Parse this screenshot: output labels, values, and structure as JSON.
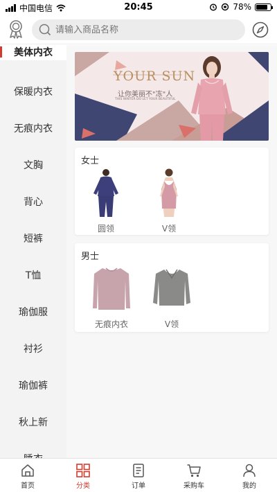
{
  "status_bar": {
    "carrier": "中国电信",
    "time": "20:45",
    "battery": "78%",
    "battery_level": 0.78
  },
  "header": {
    "search_placeholder": "请输入商品名称",
    "left_icon": "medal-icon",
    "right_icon": "compass-icon"
  },
  "sidebar": {
    "active": "美体内衣",
    "items": [
      "保暖内衣",
      "无痕内衣",
      "文胸",
      "背心",
      "短裤",
      "T恤",
      "瑜伽服",
      "衬衫",
      "瑜伽裤",
      "秋上新",
      "睡衣"
    ]
  },
  "banner": {
    "brand": "YOUR SUN",
    "slogan": "让你美丽不\"冻\"人",
    "tagline": "THIS WINTER DO LET YOUR BEAUTIFUL"
  },
  "sections": [
    {
      "title": "女士",
      "products": [
        {
          "label": "圆领"
        },
        {
          "label": "V领"
        }
      ]
    },
    {
      "title": "男士",
      "products": [
        {
          "label": "无痕内衣"
        },
        {
          "label": "V领"
        }
      ]
    }
  ],
  "tabbar": {
    "active": "分类",
    "items": [
      {
        "label": "首页",
        "icon": "home-icon"
      },
      {
        "label": "分类",
        "icon": "category-icon"
      },
      {
        "label": "订单",
        "icon": "order-icon"
      },
      {
        "label": "采购车",
        "icon": "cart-icon"
      },
      {
        "label": "我的",
        "icon": "user-icon"
      }
    ]
  },
  "colors": {
    "accent": "#d23b2e",
    "women_top": "#3d3f7a",
    "women_vest": "#d49aa6",
    "men_top_pink": "#c7a3ab",
    "men_top_gray": "#8a8a88"
  }
}
